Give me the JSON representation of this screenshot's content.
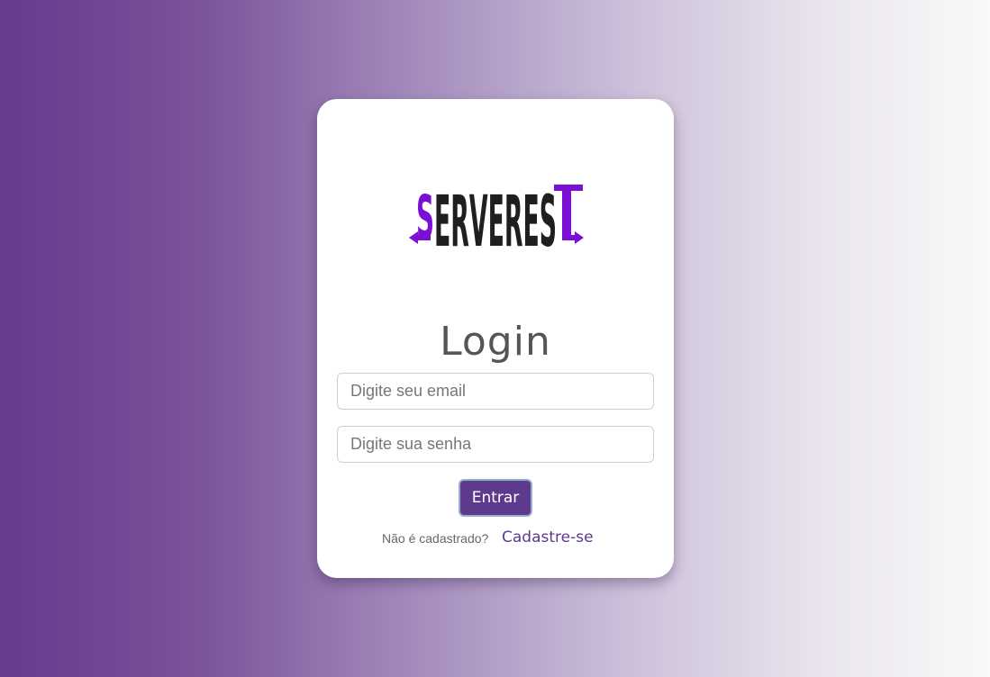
{
  "logo": {
    "text": "SERVEREST",
    "icon": "serverest-logo",
    "colors": {
      "dark": "#1f1f1f",
      "accent": "#7b0fd6"
    }
  },
  "login": {
    "title": "Login",
    "email_placeholder": "Digite seu email",
    "password_placeholder": "Digite sua senha",
    "submit_label": "Entrar",
    "signup_question": "Não é cadastrado?",
    "signup_link": "Cadastre-se"
  },
  "theme": {
    "primary": "#5e3a8c",
    "gradient_start": "#663a8e",
    "gradient_end": "#f9f9f9"
  }
}
